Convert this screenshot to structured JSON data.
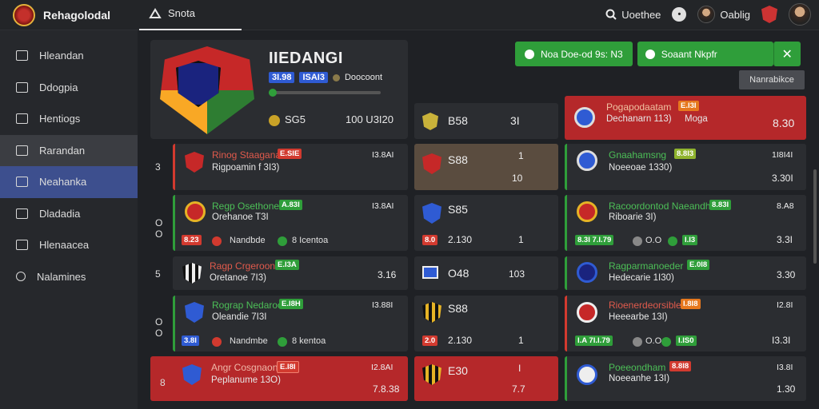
{
  "app": {
    "name": "Rehagolodal"
  },
  "topbar": {
    "tab_label": "Snota",
    "search_label": "Uoethee",
    "user_name": "Oablig"
  },
  "sidebar": {
    "items": [
      {
        "label": "Hleandan",
        "state": "normal"
      },
      {
        "label": "Ddogpia",
        "state": "normal"
      },
      {
        "label": "Hentiogs",
        "state": "normal"
      },
      {
        "label": "Rarandan",
        "state": "active-grey"
      },
      {
        "label": "Neahanka",
        "state": "active-blue"
      },
      {
        "label": "Dladadia",
        "state": "normal"
      },
      {
        "label": "Hlenaacea",
        "state": "normal"
      },
      {
        "label": "Nalamines",
        "state": "normal"
      }
    ]
  },
  "header": {
    "title": "IIEDANGI",
    "tags": [
      "3I.98",
      "ISAI3"
    ],
    "status": "Doocoont",
    "progress": 0.06,
    "stat_left": "SG5",
    "stat_right": "100 U3I20"
  },
  "actions": {
    "primary_label": "Noa Doe-od 9s: N3",
    "secondary_label": "Soaant Nkpfr",
    "close_symbol": "✕",
    "grey_button": "Nanrabikce"
  },
  "colors": {
    "accent_green": "#2f9e3a",
    "accent_red": "#b5282a",
    "accent_blue": "#3d4f8e"
  },
  "rows": {
    "r0": {
      "mid_label": "B58",
      "mid_value": "3I"
    },
    "r0_right": {
      "name": "Pogapodaatam",
      "tag": "E.I3I",
      "sub": "Dechanarn 113)",
      "extra": "Moga",
      "value": "8.30"
    },
    "r1": {
      "num": "3",
      "name": "Rinog Staagana",
      "tag": "E.SIE",
      "sub": "Rigpoamin f 3I3)",
      "value": "I3.8AI"
    },
    "r1_mid": {
      "label": "S88",
      "top": "1",
      "bottom": "10"
    },
    "r1_right": {
      "name": "Gnaahamsng",
      "tag": "8.8I3",
      "sub": "Noeeoae 1330)",
      "top": "1I8I4I",
      "value": "3.30I"
    },
    "r2": {
      "num_a": "O",
      "num_b": "O",
      "name": "Regp Osethone",
      "tag": "A.83I",
      "sub": "Orehanoe T3I",
      "value": "I3.8AI",
      "bottom_tag": "8.23",
      "bottom_text": "Nandbde",
      "bottom_value": "8 Icentoa"
    },
    "r2_mid": {
      "label": "S85",
      "bottom_tag": "8.0",
      "bottom_value": "2.130",
      "right": "1"
    },
    "r2_right": {
      "name": "Racoordontod Naeandha",
      "tag": "8.83I",
      "sub": "Riboarie 3I)",
      "top": "8.A8",
      "bottom_a": "8.3I 7.I.79",
      "bottom_b": "O.O",
      "bottom_c": "I.I3",
      "value": "3.3I"
    },
    "r3": {
      "num": "5",
      "name": "Ragp Crgeroon",
      "tag": "E.I3A",
      "sub": "Oretanoe 7I3)",
      "value": "3.16"
    },
    "r3_mid": {
      "label": "O48",
      "value": "103"
    },
    "r3_right": {
      "name": "Ragparmanoeder",
      "tag": "E.0I8",
      "sub": "Hedecarie 1I30)",
      "value": "3.30"
    },
    "r4": {
      "num_a": "O",
      "num_b": "O",
      "name": "Rograp Nedaroon",
      "tag": "E.I8H",
      "sub": "Oleandie 7I3I",
      "value": "I3.88I",
      "bottom_tag": "3.8I",
      "bottom_text": "Nandmbe",
      "bottom_value": "8 kentoa"
    },
    "r4_mid": {
      "label": "S88",
      "bottom_tag": "2.0",
      "bottom_value": "2.130",
      "right": "1"
    },
    "r4_right": {
      "name": "Rioenerdeorsibleos",
      "tag": "I.8I8",
      "sub": "Heeearbe 13I)",
      "top": "I2.8I",
      "bottom_a": "I.A 7I.I.79",
      "bottom_b": "O.O",
      "bottom_c": "I.IS0",
      "value": "I3.3I"
    },
    "r5": {
      "num": "8",
      "name": "Angr Cosgnaon",
      "tag": "E.I8I",
      "sub": "Peplanume 13O)",
      "top": "I2.8AI",
      "value": "7.8.38"
    },
    "r5_mid": {
      "label": "E30",
      "top": "I",
      "bottom": "7.7"
    },
    "r5_right": {
      "name": "Poeeondham",
      "tag": "8.8I8",
      "sub": "Noeeanhe 13I)",
      "top": "I3.8I",
      "value": "1.30"
    }
  }
}
